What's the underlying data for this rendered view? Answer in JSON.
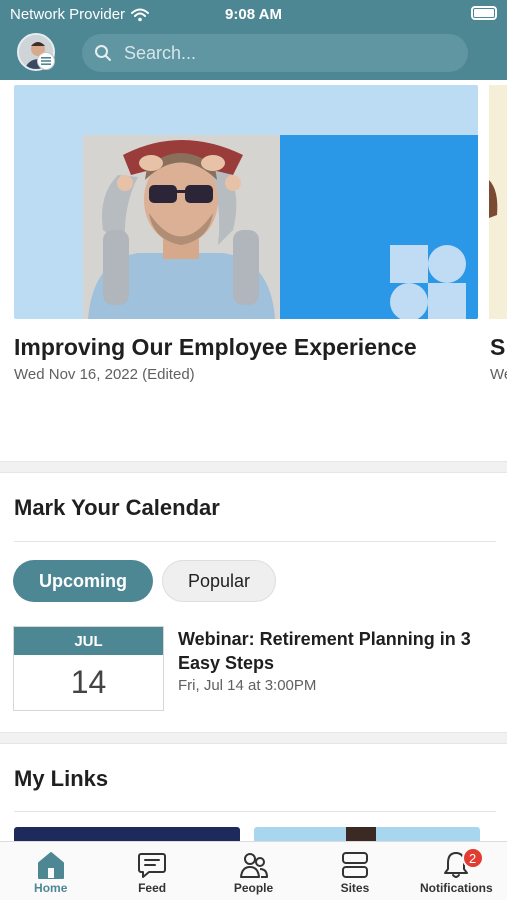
{
  "status_bar": {
    "carrier": "Network Provider",
    "time": "9:08 AM"
  },
  "header": {
    "search_placeholder": "Search..."
  },
  "news": {
    "featured": {
      "title": "Improving Our Employee Experience",
      "date": "Wed Nov 16, 2022 (Edited)"
    },
    "next_peek": {
      "title_fragment": "S",
      "sub_fragment": "We"
    }
  },
  "calendar": {
    "title": "Mark Your Calendar",
    "tabs": [
      {
        "label": "Upcoming",
        "selected": true
      },
      {
        "label": "Popular",
        "selected": false
      }
    ],
    "event": {
      "month": "JUL",
      "day": "14",
      "title": "Webinar: Retirement Planning in 3 Easy Steps",
      "time": "Fri, Jul 14 at 3:00PM"
    }
  },
  "links": {
    "title": "My Links"
  },
  "bottom_nav": {
    "items": [
      {
        "label": "Home",
        "icon": "home-icon",
        "active": true
      },
      {
        "label": "Feed",
        "icon": "feed-icon",
        "active": false
      },
      {
        "label": "People",
        "icon": "people-icon",
        "active": false
      },
      {
        "label": "Sites",
        "icon": "sites-icon",
        "active": false
      },
      {
        "label": "Notifications",
        "icon": "bell-icon",
        "active": false,
        "badge": "2"
      }
    ]
  },
  "colors": {
    "brand": "#4e8794",
    "badge": "#e23b32",
    "news_blue": "#2a98e6"
  }
}
